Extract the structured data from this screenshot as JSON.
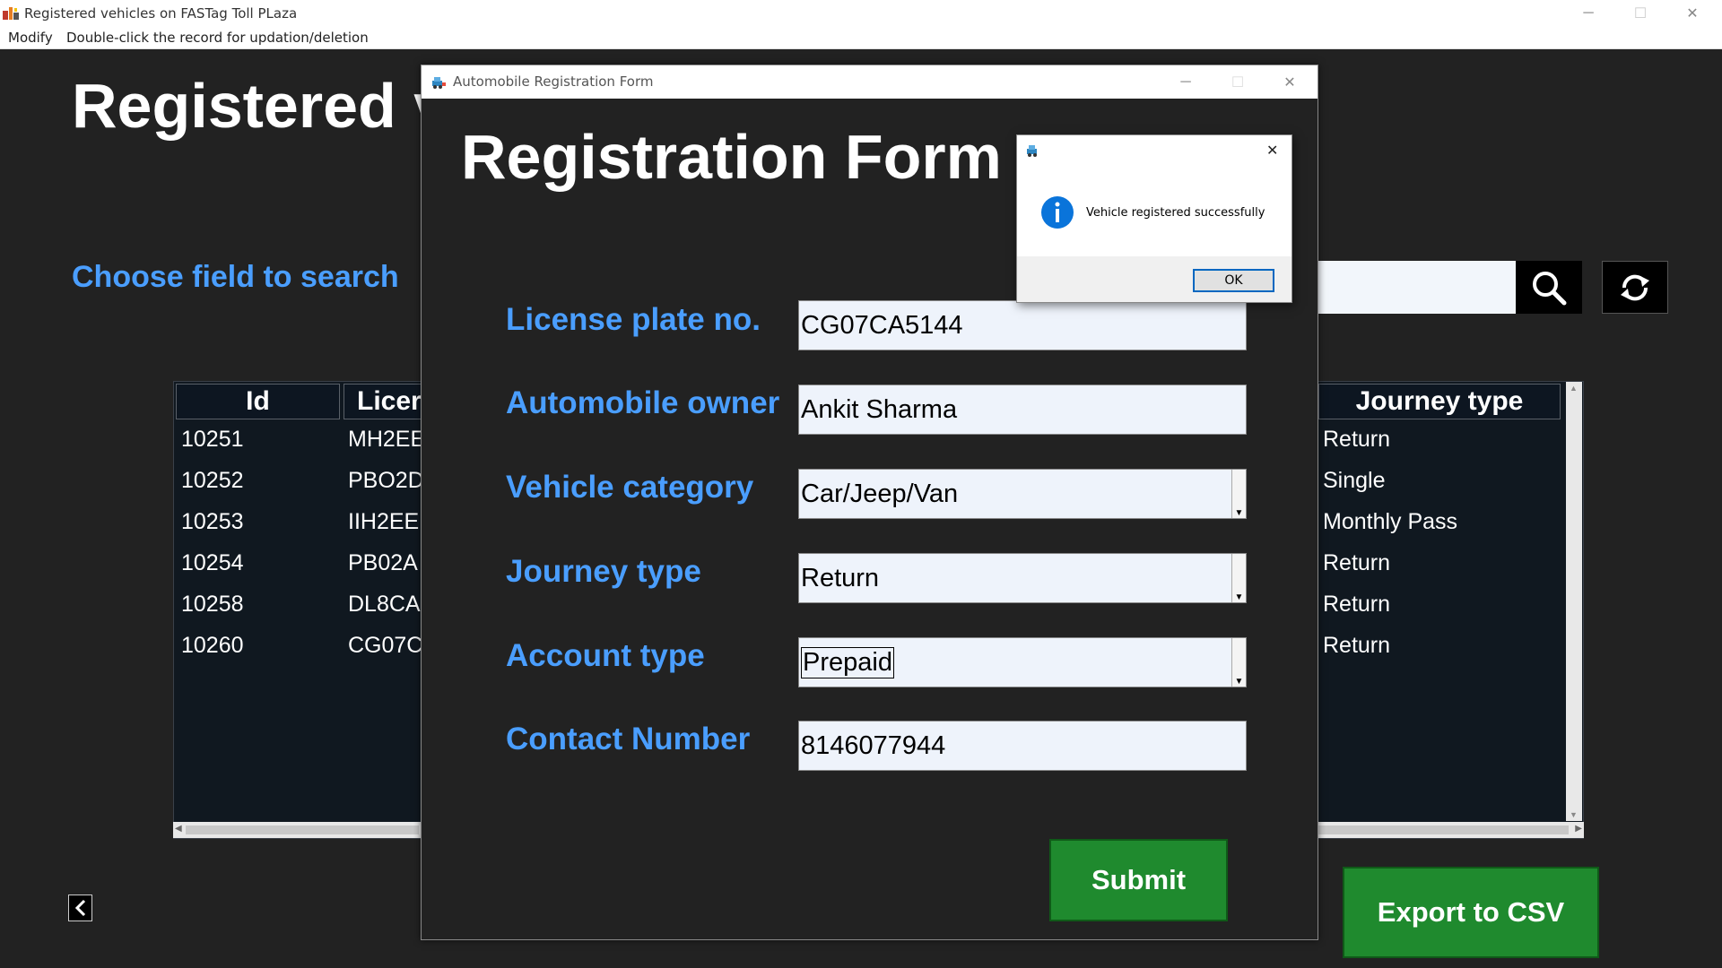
{
  "window": {
    "title": "Registered vehicles on FASTag Toll PLaza",
    "menu": [
      "Modify",
      "Double-click the record for updation/deletion"
    ]
  },
  "main": {
    "title": "Registered v",
    "search_label": "Choose field to search",
    "table": {
      "columns": [
        "Id",
        "Licer",
        "Journey type"
      ],
      "rows": [
        {
          "id": "10251",
          "license": "MH2EE",
          "journey": "Return"
        },
        {
          "id": "10252",
          "license": "PBO2D",
          "journey": "Single"
        },
        {
          "id": "10253",
          "license": "IIH2EE",
          "journey": "Monthly Pass"
        },
        {
          "id": "10254",
          "license": "PB02A",
          "journey": "Return"
        },
        {
          "id": "10258",
          "license": "DL8CA",
          "journey": "Return"
        },
        {
          "id": "10260",
          "license": "CG07C",
          "journey": "Return"
        }
      ]
    },
    "export_label": "Export to CSV",
    "icons": {
      "search": "search-icon",
      "refresh": "refresh-icon",
      "back": "chevron-left-icon"
    }
  },
  "form": {
    "window_title": "Automobile Registration Form",
    "heading": "Registration Form",
    "fields": {
      "license_label": "License plate no.",
      "license_value": "CG07CA5144",
      "owner_label": "Automobile owner",
      "owner_value": "Ankit Sharma",
      "category_label": "Vehicle category",
      "category_value": "Car/Jeep/Van",
      "journey_label": "Journey type",
      "journey_value": "Return",
      "account_label": "Account type",
      "account_value": "Prepaid",
      "contact_label": "Contact Number",
      "contact_value": "8146077944"
    },
    "submit_label": "Submit"
  },
  "messagebox": {
    "message": "Vehicle registered successfully",
    "ok_label": "OK",
    "icon": "info-icon"
  },
  "colors": {
    "background": "#222222",
    "label_blue": "#4a9eff",
    "button_green": "#1f8a2e",
    "table_bg": "#101820"
  }
}
